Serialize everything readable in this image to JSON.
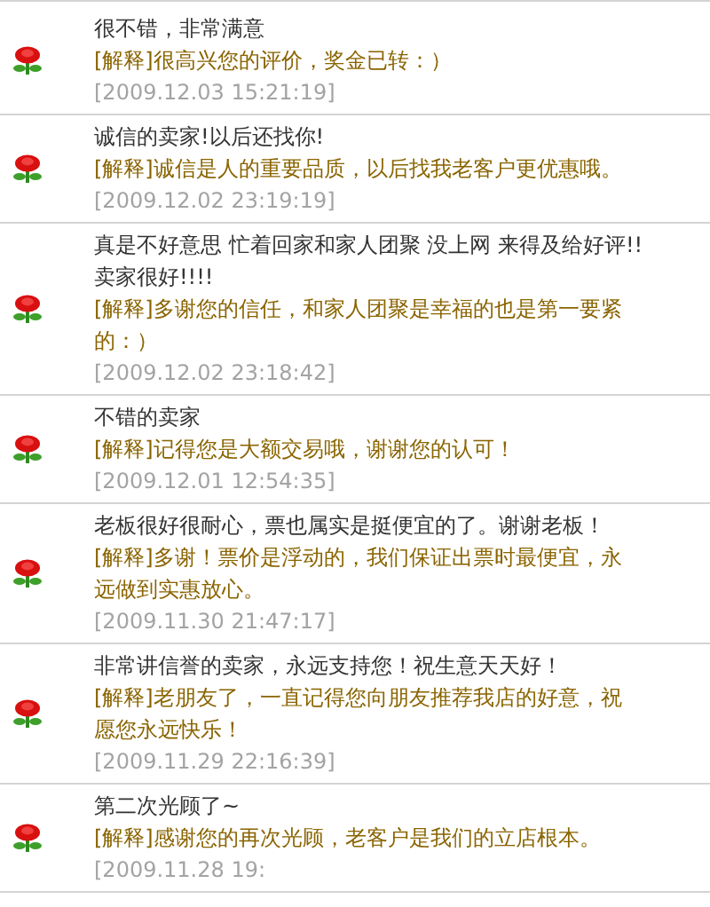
{
  "reviews": [
    {
      "comment": "很不错，非常满意",
      "reply": "[解释]很高兴您的评价，奖金已转：）",
      "date": "[2009.12.03 15:21:19]"
    },
    {
      "comment": "诚信的卖家!以后还找你!",
      "reply": "[解释]诚信是人的重要品质，以后找我老客户更优惠哦。",
      "date": "[2009.12.02 23:19:19]"
    },
    {
      "comment": "真是不好意思 忙着回家和家人团聚 没上网 来得及给好评!! 卖家很好!!!!",
      "reply": "[解释]多谢您的信任，和家人团聚是幸福的也是第一要紧的：）",
      "date": "[2009.12.02 23:18:42]"
    },
    {
      "comment": "不错的卖家",
      "reply": "[解释]记得您是大额交易哦，谢谢您的认可！",
      "date": "[2009.12.01 12:54:35]"
    },
    {
      "comment": "老板很好很耐心，票也属实是挺便宜的了。谢谢老板！",
      "reply": "[解释]多谢！票价是浮动的，我们保证出票时最便宜，永远做到实惠放心。",
      "date": "[2009.11.30 21:47:17]"
    },
    {
      "comment": "非常讲信誉的卖家，永远支持您！祝生意天天好！",
      "reply": "[解释]老朋友了，一直记得您向朋友推荐我店的好意，祝愿您永远快乐！",
      "date": "[2009.11.29 22:16:39]"
    },
    {
      "comment": "第二次光顾了~",
      "reply": "[解释]感谢您的再次光顾，老客户是我们的立店根本。",
      "date": "[2009.11.28 19:"
    }
  ]
}
